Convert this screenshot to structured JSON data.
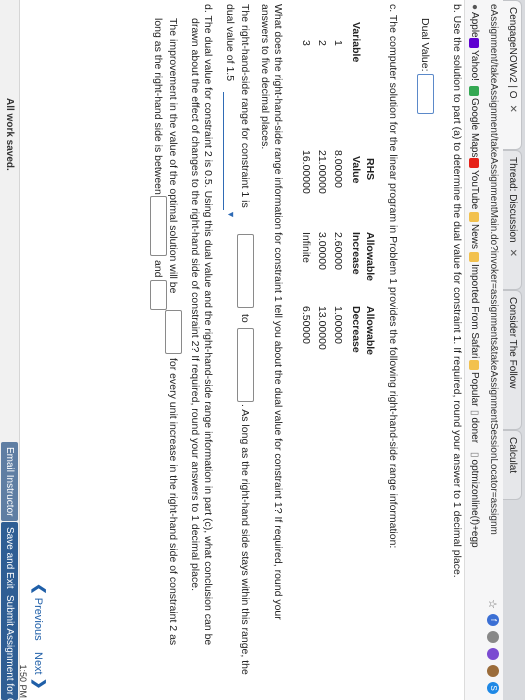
{
  "browser": {
    "tabs": [
      {
        "label": "CengageNOWv2 | O"
      },
      {
        "label": "Thread: Discussion"
      },
      {
        "label": "Consider The Follow"
      },
      {
        "label": "Calculat"
      }
    ],
    "url": "eAssignment/takeAssignment/takeAssignmentMain.do?invoker=assignments&takeAssignmentSessionLocator=assignm",
    "bookmarks": [
      "Apple",
      "Yahoo!",
      "Google Maps",
      "YouTube",
      "News",
      "Imported From Safari",
      "Popular",
      "doner",
      "optmizonline(f)+egp"
    ],
    "colors": {
      "yahoo": "#5f01d1",
      "maps": "#34a853",
      "youtube": "#e62117",
      "folder": "#f2c14e"
    }
  },
  "question": {
    "b_prompt": "b. Use the solution to part (a) to determine the dual value for constraint 1. If required, round your answer to 1 decimal place.",
    "dual_label": "Dual Value:",
    "c_prompt": "c. The computer solution for the linear program in Problem 1 provides the following right-hand-side range information:",
    "table": {
      "headers": {
        "variable": "Variable",
        "rhs_1": "RHS",
        "rhs_2": "Value",
        "inc_1": "Allowable",
        "inc_2": "Increase",
        "dec_1": "Allowable",
        "dec_2": "Decrease"
      },
      "rows": [
        {
          "var": "1",
          "rhs": "8.00000",
          "inc": "2.60000",
          "dec": "1.00000"
        },
        {
          "var": "2",
          "rhs": "21.00000",
          "inc": "3.00000",
          "dec": "13.00000"
        },
        {
          "var": "3",
          "rhs": "16.00000",
          "inc": "Infinite",
          "dec": "6.50000"
        }
      ]
    },
    "c_question_1": "What does the right-hand-side range information for constraint 1 tell you about the dual value for constraint 1? If required, round your",
    "c_question_2": "answers to five decimal places.",
    "range_1": "The right-hand-side range for constraint 1 is",
    "range_to": "to",
    "range_after": ". As long as the right-hand side stays within this range, the",
    "range_2": "dual value of 1.5",
    "d_prompt_1": "d. The dual value for constraint 2 is 0.5. Using this dual value and the right-hand-side range information in part (c), what conclusion can be",
    "d_prompt_2": "drawn about the effect of changes to the right-hand side of constraint 2? If required, round your answers to 1 decimal place.",
    "improve_1": "The improvement in the value of the optimal solution will be",
    "improve_after": "for every unit increase in the right-hand side of constraint 2 as",
    "improve_2": "long as the right-hand side is between",
    "and": "and"
  },
  "footer": {
    "previous": "Previous",
    "next": "Next",
    "saved": "All work saved.",
    "email": "Email Instructor",
    "save_exit": "Save and Exit",
    "submit": "Submit Assignment for Grading",
    "time": "1:50 PM"
  }
}
